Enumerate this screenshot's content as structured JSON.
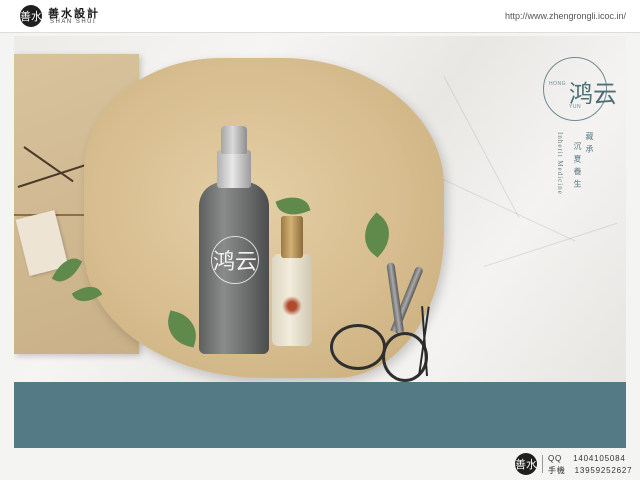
{
  "header": {
    "logo_seal_text": "善水",
    "logo_cn": "善水設計",
    "logo_en": "SHAN SHUI",
    "url": "http://www.zhengrongli.icoc.in/"
  },
  "brand": {
    "glyph": "鸿云",
    "hong": "HONG",
    "yun": "YUN",
    "vertical_cn_1": "藏 承",
    "vertical_cn_2": "沉 夏 養 生",
    "vertical_en": "Inherit Medicine"
  },
  "bottle": {
    "logo_glyph": "鸿云"
  },
  "footer": {
    "seal_text": "善水",
    "qq_label": "QQ",
    "qq_value": "1404105084",
    "phone_label": "手機",
    "phone_value": "13959252627"
  },
  "colors": {
    "teal": "#537a85",
    "kraft": "#d7bd8f"
  }
}
